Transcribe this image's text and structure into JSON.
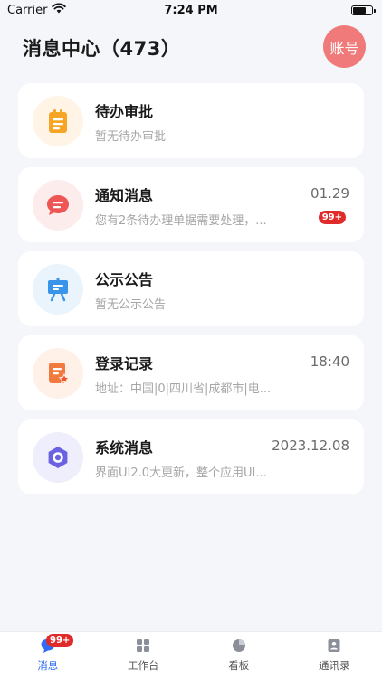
{
  "status_bar": {
    "carrier": "Carrier",
    "time": "7:24 PM"
  },
  "header": {
    "title": "消息中心（473）",
    "account_label": "账号"
  },
  "cards": [
    {
      "title": "待办审批",
      "subtitle": "暂无待办审批",
      "time": "",
      "badge": "",
      "icon": "clipboard-icon",
      "icon_bg": "#fff4e6",
      "icon_color": "#f6a524"
    },
    {
      "title": "通知消息",
      "subtitle": "您有2条待办理单据需要处理，...",
      "time": "01.29",
      "badge": "99+",
      "icon": "chat-bubble-icon",
      "icon_bg": "#fdecec",
      "icon_color": "#ee5555"
    },
    {
      "title": "公示公告",
      "subtitle": "暂无公示公告",
      "time": "",
      "badge": "",
      "icon": "presentation-board-icon",
      "icon_bg": "#e9f4fd",
      "icon_color": "#3a95ea"
    },
    {
      "title": "登录记录",
      "subtitle": "地址：中国|0|四川省|成都市|电...",
      "time": "18:40",
      "badge": "",
      "icon": "document-star-icon",
      "icon_bg": "#fff0e8",
      "icon_color": "#f27a3e"
    },
    {
      "title": "系统消息",
      "subtitle": "界面UI2.0大更新，整个应用UI...",
      "time": "2023.12.08",
      "badge": "",
      "icon": "gear-icon",
      "icon_bg": "#eeeefc",
      "icon_color": "#6a62e0"
    }
  ],
  "tabbar": {
    "tabs": [
      {
        "label": "消息",
        "badge": "99+",
        "icon": "message-icon",
        "active": true
      },
      {
        "label": "工作台",
        "badge": "",
        "icon": "grid-icon",
        "active": false
      },
      {
        "label": "看板",
        "badge": "",
        "icon": "dashboard-icon",
        "active": false
      },
      {
        "label": "通讯录",
        "badge": "",
        "icon": "contacts-icon",
        "active": false
      }
    ]
  },
  "colors": {
    "accent": "#2f6df6",
    "badge": "#e02b2b",
    "account_button": "#f07a7a",
    "background": "#f4f6fa"
  }
}
